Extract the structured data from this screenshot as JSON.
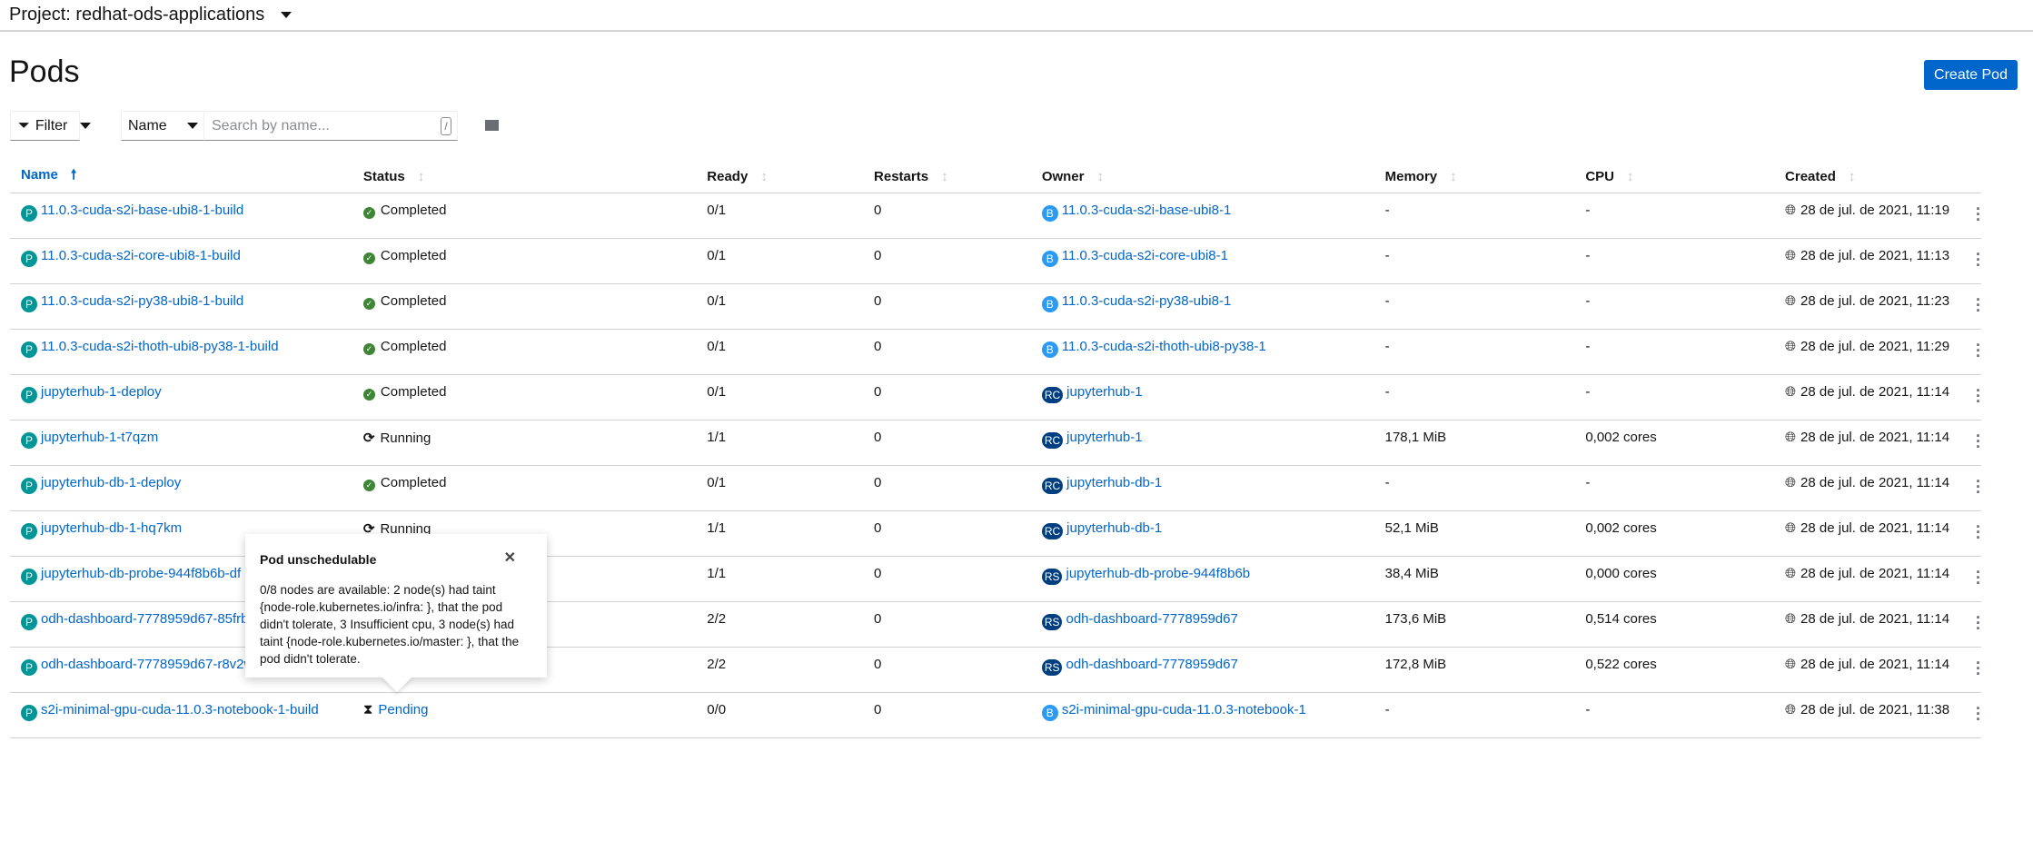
{
  "project": {
    "label": "Project: redhat-ods-applications"
  },
  "page": {
    "title": "Pods",
    "create_label": "Create Pod"
  },
  "toolbar": {
    "filter_label": "Filter",
    "attribute_label": "Name",
    "search_placeholder": "Search by name...",
    "shortcut": "/"
  },
  "columns": [
    "Name",
    "Status",
    "Ready",
    "Restarts",
    "Owner",
    "Memory",
    "CPU",
    "Created"
  ],
  "colors": {
    "P": "#009596",
    "B": "#2b9af3",
    "RC": "#003f7f",
    "RS": "#003f7f",
    "link": "#0066cc",
    "completed": "#3e8635"
  },
  "rows": [
    {
      "name": "11.0.3-cuda-s2i-base-ubi8-1-build",
      "status": "Completed",
      "ready": "0/1",
      "restarts": "0",
      "owner_kind": "B",
      "owner": "11.0.3-cuda-s2i-base-ubi8-1",
      "memory": "-",
      "cpu": "-",
      "created": "28 de jul. de 2021, 11:19"
    },
    {
      "name": "11.0.3-cuda-s2i-core-ubi8-1-build",
      "status": "Completed",
      "ready": "0/1",
      "restarts": "0",
      "owner_kind": "B",
      "owner": "11.0.3-cuda-s2i-core-ubi8-1",
      "memory": "-",
      "cpu": "-",
      "created": "28 de jul. de 2021, 11:13"
    },
    {
      "name": "11.0.3-cuda-s2i-py38-ubi8-1-build",
      "status": "Completed",
      "ready": "0/1",
      "restarts": "0",
      "owner_kind": "B",
      "owner": "11.0.3-cuda-s2i-py38-ubi8-1",
      "memory": "-",
      "cpu": "-",
      "created": "28 de jul. de 2021, 11:23"
    },
    {
      "name": "11.0.3-cuda-s2i-thoth-ubi8-py38-1-build",
      "status": "Completed",
      "ready": "0/1",
      "restarts": "0",
      "owner_kind": "B",
      "owner": "11.0.3-cuda-s2i-thoth-ubi8-py38-1",
      "memory": "-",
      "cpu": "-",
      "created": "28 de jul. de 2021, 11:29"
    },
    {
      "name": "jupyterhub-1-deploy",
      "status": "Completed",
      "ready": "0/1",
      "restarts": "0",
      "owner_kind": "RC",
      "owner": "jupyterhub-1",
      "memory": "-",
      "cpu": "-",
      "created": "28 de jul. de 2021, 11:14"
    },
    {
      "name": "jupyterhub-1-t7qzm",
      "status": "Running",
      "ready": "1/1",
      "restarts": "0",
      "owner_kind": "RC",
      "owner": "jupyterhub-1",
      "memory": "178,1 MiB",
      "cpu": "0,002 cores",
      "created": "28 de jul. de 2021, 11:14"
    },
    {
      "name": "jupyterhub-db-1-deploy",
      "status": "Completed",
      "ready": "0/1",
      "restarts": "0",
      "owner_kind": "RC",
      "owner": "jupyterhub-db-1",
      "memory": "-",
      "cpu": "-",
      "created": "28 de jul. de 2021, 11:14"
    },
    {
      "name": "jupyterhub-db-1-hq7km",
      "status": "Running",
      "ready": "1/1",
      "restarts": "0",
      "owner_kind": "RC",
      "owner": "jupyterhub-db-1",
      "memory": "52,1 MiB",
      "cpu": "0,002 cores",
      "created": "28 de jul. de 2021, 11:14"
    },
    {
      "name": "jupyterhub-db-probe-944f8b6b-df",
      "status": "",
      "ready": "1/1",
      "restarts": "0",
      "owner_kind": "RS",
      "owner": "jupyterhub-db-probe-944f8b6b",
      "memory": "38,4 MiB",
      "cpu": "0,000 cores",
      "created": "28 de jul. de 2021, 11:14"
    },
    {
      "name": "odh-dashboard-7778959d67-85frb",
      "status": "",
      "ready": "2/2",
      "restarts": "0",
      "owner_kind": "RS",
      "owner": "odh-dashboard-7778959d67",
      "memory": "173,6 MiB",
      "cpu": "0,514 cores",
      "created": "28 de jul. de 2021, 11:14"
    },
    {
      "name": "odh-dashboard-7778959d67-r8v2w",
      "status": "",
      "ready": "2/2",
      "restarts": "0",
      "owner_kind": "RS",
      "owner": "odh-dashboard-7778959d67",
      "memory": "172,8 MiB",
      "cpu": "0,522 cores",
      "created": "28 de jul. de 2021, 11:14"
    },
    {
      "name": "s2i-minimal-gpu-cuda-11.0.3-notebook-1-build",
      "status": "Pending",
      "ready": "0/0",
      "restarts": "0",
      "owner_kind": "B",
      "owner": "s2i-minimal-gpu-cuda-11.0.3-notebook-1",
      "memory": "-",
      "cpu": "-",
      "created": "28 de jul. de 2021, 11:38"
    }
  ],
  "popover": {
    "title": "Pod unschedulable",
    "body": "0/8 nodes are available: 2 node(s) had taint {node-role.kubernetes.io/infra: }, that the pod didn't tolerate, 3 Insufficient cpu, 3 node(s) had taint {node-role.kubernetes.io/master: }, that the pod didn't tolerate."
  }
}
